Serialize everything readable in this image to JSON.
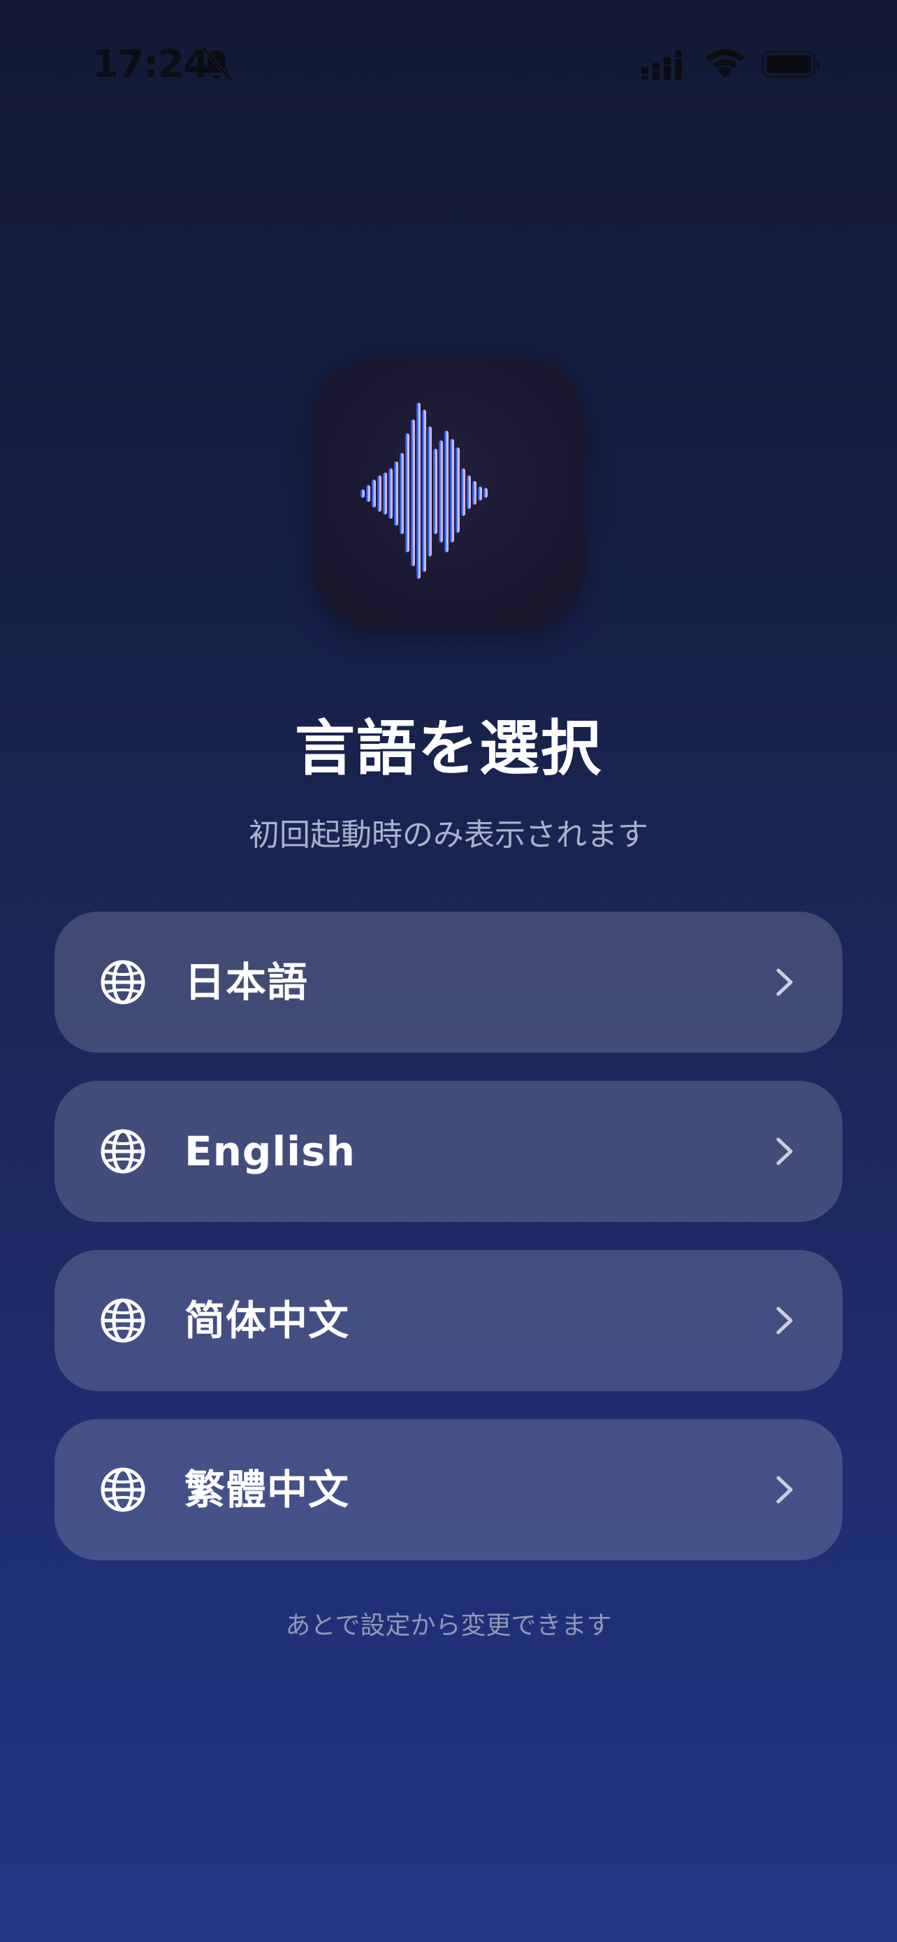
{
  "status_bar": {
    "time": "17:24",
    "icons": [
      "bell-slash-icon",
      "cellular-signal-icon",
      "wifi-icon",
      "battery-icon"
    ]
  },
  "app_icon": {
    "name": "waveform-icon",
    "colors": {
      "background": "#1b1a31",
      "blue": "#2f6dff",
      "light_blue": "#8fb8ff",
      "purple": "#b59af0",
      "pink": "#f3b3c6"
    }
  },
  "header": {
    "title": "言語を選択",
    "subtitle": "初回起動時のみ表示されます"
  },
  "languages": [
    {
      "label": "日本語",
      "icon": "globe-icon",
      "trailing_icon": "chevron-right-icon"
    },
    {
      "label": "English",
      "icon": "globe-icon",
      "trailing_icon": "chevron-right-icon"
    },
    {
      "label": "简体中文",
      "icon": "globe-icon",
      "trailing_icon": "chevron-right-icon"
    },
    {
      "label": "繁體中文",
      "icon": "globe-icon",
      "trailing_icon": "chevron-right-icon"
    }
  ],
  "footer": {
    "note": "あとで設定から変更できます"
  },
  "colors": {
    "background_top": "#121a33",
    "background_bottom": "#223684",
    "row_fill": "rgba(255,255,255,0.17)",
    "subtitle_text": "#a9b2cc",
    "footer_text": "#8f98b6"
  }
}
